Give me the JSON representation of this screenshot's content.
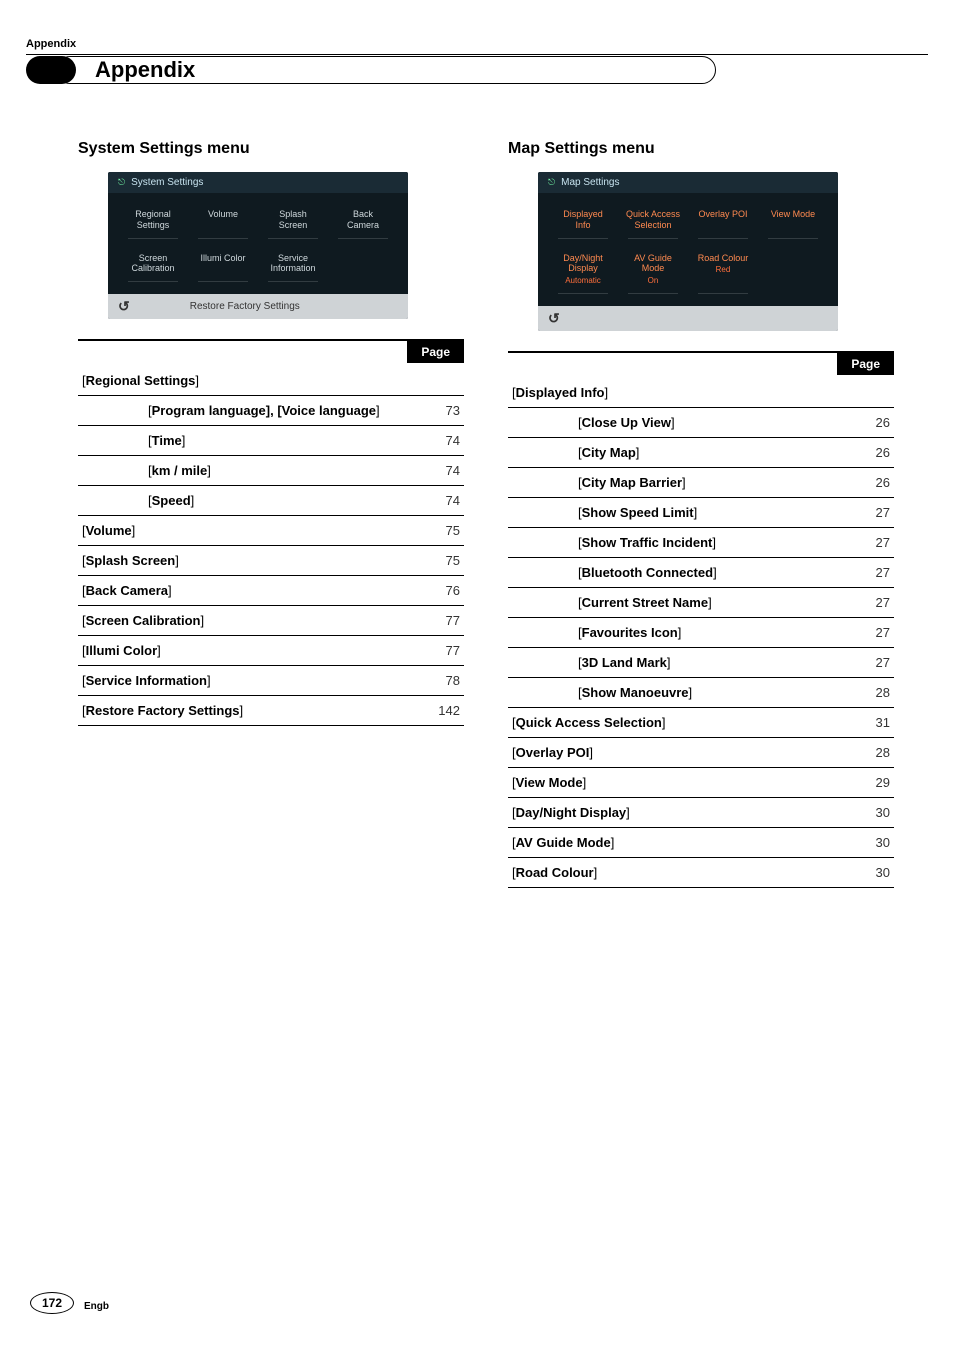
{
  "breadcrumb": "Appendix",
  "chapter_title": "Appendix",
  "page_header_label": "Page",
  "left": {
    "heading_plain": "System Settings ",
    "heading_heavy": "menu",
    "shot": {
      "title": "System Settings",
      "cells": [
        {
          "t": "Regional\nSettings"
        },
        {
          "t": "Volume"
        },
        {
          "t": "Splash\nScreen"
        },
        {
          "t": "Back\nCamera"
        },
        {
          "t": "Screen\nCalibration"
        },
        {
          "t": "Illumi Color"
        },
        {
          "t": "Service\nInformation"
        },
        {
          "t": ""
        }
      ],
      "footer_center": "Restore Factory Settings"
    },
    "rows": [
      {
        "type": "hdr",
        "label": "Regional Settings",
        "page": ""
      },
      {
        "type": "sub",
        "label": "Program language], [Voice language",
        "page": "73"
      },
      {
        "type": "sub",
        "label": "Time",
        "page": "74"
      },
      {
        "type": "sub",
        "label": "km / mile",
        "page": "74"
      },
      {
        "type": "sub",
        "label": "Speed",
        "page": "74"
      },
      {
        "type": "row",
        "label": "Volume",
        "page": "75"
      },
      {
        "type": "row",
        "label": "Splash Screen",
        "page": "75"
      },
      {
        "type": "row",
        "label": "Back Camera",
        "page": "76"
      },
      {
        "type": "row",
        "label": "Screen Calibration",
        "page": "77"
      },
      {
        "type": "row",
        "label": "Illumi Color",
        "page": "77"
      },
      {
        "type": "row",
        "label": "Service Information",
        "page": "78"
      },
      {
        "type": "row",
        "label": "Restore Factory Settings",
        "page": "142"
      }
    ]
  },
  "right": {
    "heading_plain": "Map Settings ",
    "heading_heavy": "menu",
    "shot": {
      "title": "Map Settings",
      "cells": [
        {
          "t": "Displayed\nInfo",
          "orange": true
        },
        {
          "t": "Quick Access\nSelection",
          "orange": true
        },
        {
          "t": "Overlay POI",
          "orange": true
        },
        {
          "t": "View Mode",
          "orange": true
        },
        {
          "t": "Day/Night\nDisplay",
          "orange": true,
          "sub": "Automatic"
        },
        {
          "t": "AV Guide\nMode",
          "orange": true,
          "sub": "On"
        },
        {
          "t": "Road Colour",
          "orange": true,
          "sub": "Red"
        },
        {
          "t": ""
        }
      ],
      "footer_center": ""
    },
    "rows": [
      {
        "type": "hdr",
        "label": "Displayed Info",
        "page": ""
      },
      {
        "type": "sub",
        "label": "Close Up View",
        "page": "26"
      },
      {
        "type": "sub",
        "label": "City Map",
        "page": "26"
      },
      {
        "type": "sub",
        "label": "City Map Barrier",
        "page": "26"
      },
      {
        "type": "sub",
        "label": "Show Speed Limit",
        "page": "27"
      },
      {
        "type": "sub",
        "label": "Show Traffic Incident",
        "page": "27"
      },
      {
        "type": "sub",
        "label": "Bluetooth Connected",
        "page": "27"
      },
      {
        "type": "sub",
        "label": "Current Street Name",
        "page": "27"
      },
      {
        "type": "sub",
        "label": "Favourites Icon",
        "page": "27"
      },
      {
        "type": "sub",
        "label": "3D Land Mark",
        "page": "27"
      },
      {
        "type": "sub",
        "label": "Show Manoeuvre",
        "page": "28"
      },
      {
        "type": "row",
        "label": "Quick Access Selection",
        "page": "31"
      },
      {
        "type": "row",
        "label": "Overlay POI",
        "page": "28"
      },
      {
        "type": "row",
        "label": "View Mode",
        "page": "29"
      },
      {
        "type": "row",
        "label": "Day/Night Display",
        "page": "30"
      },
      {
        "type": "row",
        "label": "AV Guide Mode",
        "page": "30"
      },
      {
        "type": "row",
        "label": "Road Colour",
        "page": "30"
      }
    ]
  },
  "page_number": "172",
  "engb": "Engb"
}
